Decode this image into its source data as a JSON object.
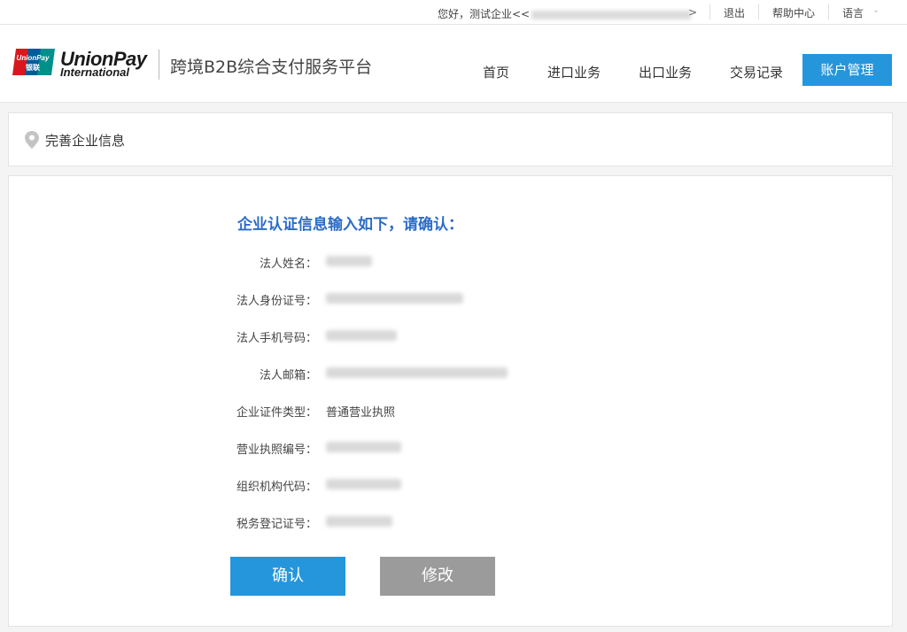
{
  "topbar": {
    "greeting": "您好，测试企业<<",
    "greeting_suffix": ">",
    "logout": "退出",
    "help": "帮助中心",
    "language": "语言"
  },
  "header": {
    "logo_line1": "UnionPay",
    "logo_line2": "International",
    "logo_mark_text_top": "UnionPay",
    "logo_mark_text_bottom": "银联",
    "platform_title": "跨境B2B综合支付服务平台",
    "nav": [
      "首页",
      "进口业务",
      "出口业务",
      "交易记录",
      "账户管理"
    ]
  },
  "breadcrumb": {
    "label": "完善企业信息"
  },
  "confirm": {
    "title": "企业认证信息输入如下，请确认：",
    "fields": [
      {
        "label": "法人姓名：",
        "value": ""
      },
      {
        "label": "法人身份证号：",
        "value": ""
      },
      {
        "label": "法人手机号码：",
        "value": ""
      },
      {
        "label": "法人邮箱：",
        "value": ""
      },
      {
        "label": "企业证件类型：",
        "value": "普通营业执照"
      },
      {
        "label": "营业执照编号：",
        "value": ""
      },
      {
        "label": "组织机构代码：",
        "value": ""
      },
      {
        "label": "税务登记证号：",
        "value": ""
      }
    ],
    "confirm_button": "确认",
    "edit_button": "修改"
  },
  "colors": {
    "accent": "#2596dc",
    "title_blue": "#2a6cc7",
    "secondary_button": "#9b9b9b",
    "unionpay_red": "#d7191f",
    "unionpay_blue": "#005b9a",
    "unionpay_teal": "#00908c"
  }
}
